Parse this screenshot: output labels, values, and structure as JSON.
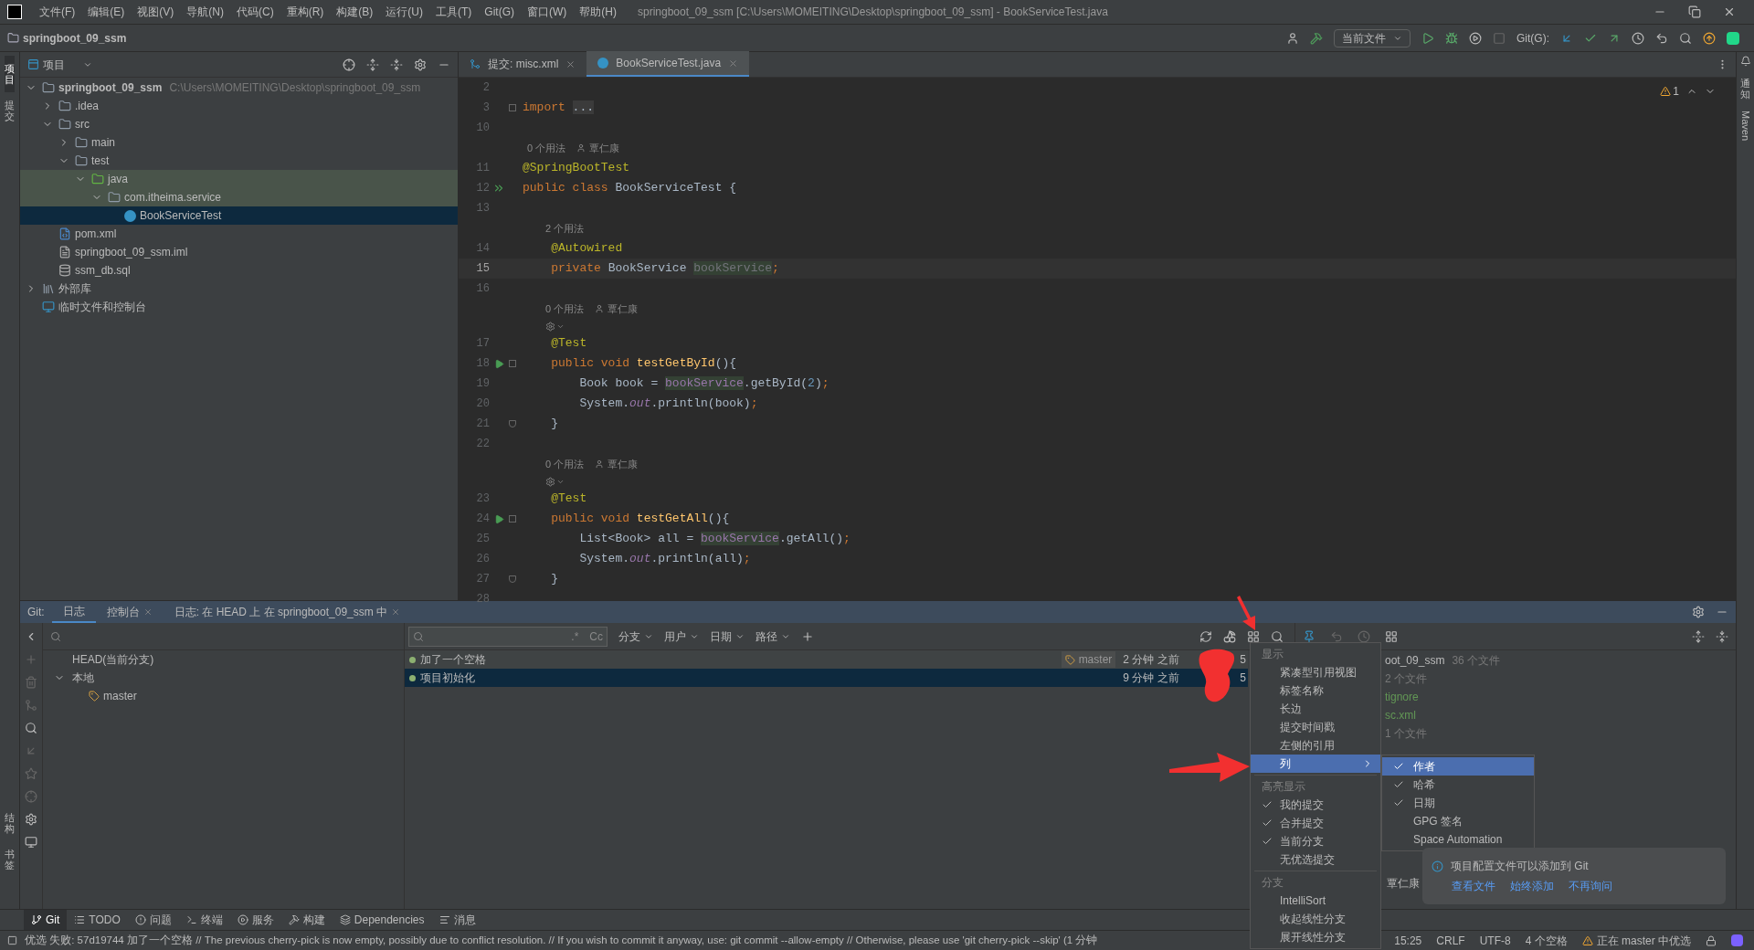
{
  "menu_bar": {
    "items": [
      "文件(F)",
      "编辑(E)",
      "视图(V)",
      "导航(N)",
      "代码(C)",
      "重构(R)",
      "构建(B)",
      "运行(U)",
      "工具(T)",
      "Git(G)",
      "窗口(W)",
      "帮助(H)"
    ],
    "title": "springboot_09_ssm [C:\\Users\\MOMEITING\\Desktop\\springboot_09_ssm] - BookServiceTest.java"
  },
  "nav_bar": {
    "project": "springboot_09_ssm",
    "run_config": "当前文件",
    "git_label": "Git(G):"
  },
  "left_strip": {
    "top": [
      {
        "label": "项目",
        "selected": true
      },
      {
        "label": "提交",
        "selected": false
      }
    ],
    "bottom": [
      {
        "label": "结构",
        "selected": false
      },
      {
        "label": "书签",
        "selected": false
      }
    ]
  },
  "right_strip": {
    "items": [
      {
        "label": "通知",
        "kind": "cjk"
      },
      {
        "label": "Maven",
        "kind": "latin"
      }
    ]
  },
  "project_panel": {
    "title": "项目",
    "tree": [
      {
        "label": "springboot_09_ssm",
        "hint": "C:\\Users\\MOMEITING\\Desktop\\springboot_09_ssm",
        "kind": "module",
        "expanded": true,
        "selected": false,
        "children": [
          {
            "label": ".idea",
            "kind": "folder",
            "expanded": false,
            "selected": false
          },
          {
            "label": "src",
            "kind": "folder",
            "expanded": true,
            "selected": false,
            "children": [
              {
                "label": "main",
                "kind": "folder",
                "expanded": false,
                "selected": false
              },
              {
                "label": "test",
                "kind": "folder",
                "expanded": true,
                "selected": false,
                "children": [
                  {
                    "label": "java",
                    "kind": "test-folder",
                    "expanded": true,
                    "selected": false,
                    "highlight": true,
                    "children": [
                      {
                        "label": "com.itheima.service",
                        "kind": "package",
                        "expanded": true,
                        "selected": false,
                        "highlight": true,
                        "children": [
                          {
                            "label": "BookServiceTest",
                            "kind": "class",
                            "selected": true
                          }
                        ]
                      }
                    ]
                  }
                ]
              }
            ]
          },
          {
            "label": "pom.xml",
            "kind": "maven",
            "selected": false
          },
          {
            "label": "springboot_09_ssm.iml",
            "kind": "iml",
            "selected": false
          },
          {
            "label": "ssm_db.sql",
            "kind": "sql",
            "selected": false
          }
        ]
      },
      {
        "label": "外部库",
        "kind": "library",
        "expanded": false,
        "selected": false
      },
      {
        "label": "临时文件和控制台",
        "kind": "scratch",
        "selected": false
      }
    ]
  },
  "editor": {
    "tabs": [
      {
        "label": "提交: misc.xml",
        "kind": "commit",
        "selected": false
      },
      {
        "label": "BookServiceTest.java",
        "kind": "class",
        "selected": true
      }
    ],
    "warnings": "1",
    "lines": [
      {
        "kind": "code",
        "number": "2",
        "current": false
      },
      {
        "kind": "code",
        "number": "3",
        "current": false,
        "fold": {
          "kind": "start"
        },
        "tokens": [
          {
            "t": "import ",
            "kind": "kw"
          },
          {
            "t": "...",
            "kind": "folded"
          }
        ]
      },
      {
        "kind": "code",
        "number": "10",
        "current": false
      },
      {
        "kind": "hint",
        "nested": false,
        "text": "0 个用法",
        "author": "覃仁康"
      },
      {
        "kind": "code",
        "number": "11",
        "current": false,
        "tokens": [
          {
            "t": "@SpringBootTest",
            "kind": "ann"
          }
        ]
      },
      {
        "kind": "code",
        "number": "12",
        "current": false,
        "gutter": {
          "kind": "run-all"
        },
        "tokens": [
          {
            "t": "public class ",
            "kind": "kw"
          },
          {
            "t": "BookServiceTest {",
            "kind": "plain"
          }
        ]
      },
      {
        "kind": "code",
        "number": "13",
        "current": false
      },
      {
        "kind": "hint",
        "nested": true,
        "text": "2 个用法"
      },
      {
        "kind": "code",
        "number": "14",
        "current": false,
        "tokens": [
          {
            "t": "    @Autowired",
            "kind": "ann"
          }
        ]
      },
      {
        "kind": "code",
        "number": "15",
        "current": true,
        "tokens": [
          {
            "t": "    private ",
            "kind": "kw"
          },
          {
            "t": "BookService ",
            "kind": "plain"
          },
          {
            "t": "bookService",
            "kind": "unused"
          },
          {
            "t": ";",
            "kind": "kw"
          }
        ]
      },
      {
        "kind": "code",
        "number": "16",
        "current": false
      },
      {
        "kind": "hint",
        "nested": true,
        "text": "0 个用法",
        "author": "覃仁康"
      },
      {
        "kind": "inlay"
      },
      {
        "kind": "code",
        "number": "17",
        "current": false,
        "tokens": [
          {
            "t": "    @Test",
            "kind": "ann"
          }
        ]
      },
      {
        "kind": "code",
        "number": "18",
        "current": false,
        "gutter": {
          "kind": "run"
        },
        "fold": {
          "kind": "start"
        },
        "tokens": [
          {
            "t": "    public void ",
            "kind": "kw"
          },
          {
            "t": "testGetById",
            "kind": "method"
          },
          {
            "t": "(){",
            "kind": "plain"
          }
        ]
      },
      {
        "kind": "code",
        "number": "19",
        "current": false,
        "tokens": [
          {
            "t": "        Book book = ",
            "kind": "plain"
          },
          {
            "t": "bookService",
            "kind": "field"
          },
          {
            "t": ".getById(",
            "kind": "plain"
          },
          {
            "t": "2",
            "kind": "num"
          },
          {
            "t": ")",
            "kind": "plain"
          },
          {
            "t": ";",
            "kind": "kw"
          }
        ]
      },
      {
        "kind": "code",
        "number": "20",
        "current": false,
        "tokens": [
          {
            "t": "        System.",
            "kind": "plain"
          },
          {
            "t": "out",
            "kind": "static"
          },
          {
            "t": ".println(book)",
            "kind": "plain"
          },
          {
            "t": ";",
            "kind": "kw"
          }
        ]
      },
      {
        "kind": "code",
        "number": "21",
        "current": false,
        "fold": {
          "kind": "end"
        },
        "tokens": [
          {
            "t": "    }",
            "kind": "plain"
          }
        ]
      },
      {
        "kind": "code",
        "number": "22",
        "current": false
      },
      {
        "kind": "hint",
        "nested": true,
        "text": "0 个用法",
        "author": "覃仁康"
      },
      {
        "kind": "inlay"
      },
      {
        "kind": "code",
        "number": "23",
        "current": false,
        "tokens": [
          {
            "t": "    @Test",
            "kind": "ann"
          }
        ]
      },
      {
        "kind": "code",
        "number": "24",
        "current": false,
        "gutter": {
          "kind": "run"
        },
        "fold": {
          "kind": "start"
        },
        "tokens": [
          {
            "t": "    public void ",
            "kind": "kw"
          },
          {
            "t": "testGetAll",
            "kind": "method"
          },
          {
            "t": "(){",
            "kind": "plain"
          }
        ]
      },
      {
        "kind": "code",
        "number": "25",
        "current": false,
        "tokens": [
          {
            "t": "        List<Book> all = ",
            "kind": "plain"
          },
          {
            "t": "bookService",
            "kind": "field"
          },
          {
            "t": ".getAll()",
            "kind": "plain"
          },
          {
            "t": ";",
            "kind": "kw"
          }
        ]
      },
      {
        "kind": "code",
        "number": "26",
        "current": false,
        "tokens": [
          {
            "t": "        System.",
            "kind": "plain"
          },
          {
            "t": "out",
            "kind": "static"
          },
          {
            "t": ".println(all)",
            "kind": "plain"
          },
          {
            "t": ";",
            "kind": "kw"
          }
        ]
      },
      {
        "kind": "code",
        "number": "27",
        "current": false,
        "fold": {
          "kind": "end"
        },
        "tokens": [
          {
            "t": "    }",
            "kind": "plain"
          }
        ]
      },
      {
        "kind": "code",
        "number": "28",
        "current": false
      }
    ]
  },
  "git_panel": {
    "label": "Git:",
    "tabs": [
      {
        "label": "日志",
        "selected": true,
        "closable": false
      },
      {
        "label": "控制台",
        "selected": false,
        "closable": true
      },
      {
        "label": "日志: 在 HEAD 上 在 springboot_09_ssm 中",
        "selected": false,
        "closable": true
      }
    ],
    "branches": [
      {
        "label": "HEAD(当前分支)"
      },
      {
        "label": "本地",
        "expanded": true,
        "children": [
          {
            "label": "master"
          }
        ]
      }
    ],
    "log": {
      "regex": ".*",
      "case": "Cc",
      "filters": [
        "分支",
        "用户",
        "日期",
        "路径"
      ],
      "rows": [
        {
          "subject": "加了一个空格",
          "tag": "master",
          "date": "2 分钟 之前",
          "hash": "5",
          "selected": false
        },
        {
          "subject": "项目初始化",
          "date": "9 分钟 之前",
          "hash": "5",
          "selected": true
        }
      ]
    },
    "details": {
      "rows": [
        {
          "text": "oot_09_ssm",
          "count": "36 个文件",
          "added": false
        },
        {
          "count": "2 个文件"
        },
        {
          "text": "tignore",
          "added": true
        },
        {
          "text": "sc.xml",
          "added": true
        },
        {
          "count": "1 个文件"
        }
      ],
      "author": "覃仁康"
    }
  },
  "context_menu": {
    "sections": [
      {
        "header": "显示",
        "items": [
          {
            "label": "紧凑型引用视图",
            "checked": false,
            "selected": false,
            "submenu": false
          },
          {
            "label": "标签名称",
            "checked": false,
            "selected": false,
            "submenu": false
          },
          {
            "label": "长边",
            "checked": false,
            "selected": false,
            "submenu": false
          },
          {
            "label": "提交时间戳",
            "checked": false,
            "selected": false,
            "submenu": false
          },
          {
            "label": "左侧的引用",
            "checked": false,
            "selected": false,
            "submenu": false
          },
          {
            "label": "列",
            "checked": false,
            "selected": true,
            "submenu": true
          }
        ]
      },
      {
        "header": "高亮显示",
        "items": [
          {
            "label": "我的提交",
            "checked": true,
            "selected": false,
            "submenu": false
          },
          {
            "label": "合并提交",
            "checked": true,
            "selected": false,
            "submenu": false
          },
          {
            "label": "当前分支",
            "checked": true,
            "selected": false,
            "submenu": false
          },
          {
            "label": "无优选提交",
            "checked": false,
            "selected": false,
            "submenu": false
          }
        ]
      },
      {
        "header": "分支",
        "items": [
          {
            "label": "IntelliSort",
            "checked": false,
            "selected": false,
            "submenu": false
          },
          {
            "label": "收起线性分支",
            "checked": false,
            "selected": false,
            "submenu": false
          },
          {
            "label": "展开线性分支",
            "checked": false,
            "selected": false,
            "submenu": false
          }
        ]
      }
    ],
    "submenu": [
      {
        "label": "作者",
        "checked": true,
        "selected": true
      },
      {
        "label": "哈希",
        "checked": true,
        "selected": false
      },
      {
        "label": "日期",
        "checked": true,
        "selected": false
      },
      {
        "label": "GPG 签名",
        "checked": false,
        "selected": false
      },
      {
        "label": "Space Automation",
        "checked": false,
        "selected": false
      }
    ]
  },
  "notification": {
    "text": "项目配置文件可以添加到 Git",
    "links": [
      "查看文件",
      "始终添加",
      "不再询问"
    ]
  },
  "tool_bar": [
    {
      "label": "Git",
      "kind": "git",
      "selected": true
    },
    {
      "label": "TODO",
      "kind": "todo",
      "selected": false
    },
    {
      "label": "问题",
      "kind": "problems",
      "selected": false
    },
    {
      "label": "终端",
      "kind": "terminal",
      "selected": false
    },
    {
      "label": "服务",
      "kind": "services",
      "selected": false
    },
    {
      "label": "构建",
      "kind": "build",
      "selected": false
    },
    {
      "label": "Dependencies",
      "kind": "deps",
      "selected": false
    },
    {
      "label": "消息",
      "kind": "messages",
      "selected": false
    }
  ],
  "status_bar": {
    "message": "优选 失败: 57d19744 加了一个空格 // The previous cherry-pick is now empty, possibly due to conflict resolution. // If you wish to commit it anyway, use: git commit --allow-empty // Otherwise, please use 'git cherry-pick --skip' (1 分钟",
    "position": "15:25",
    "line_ending": "CRLF",
    "encoding": "UTF-8",
    "indent": "4 个空格",
    "vcs": "正在 master 中优选"
  }
}
